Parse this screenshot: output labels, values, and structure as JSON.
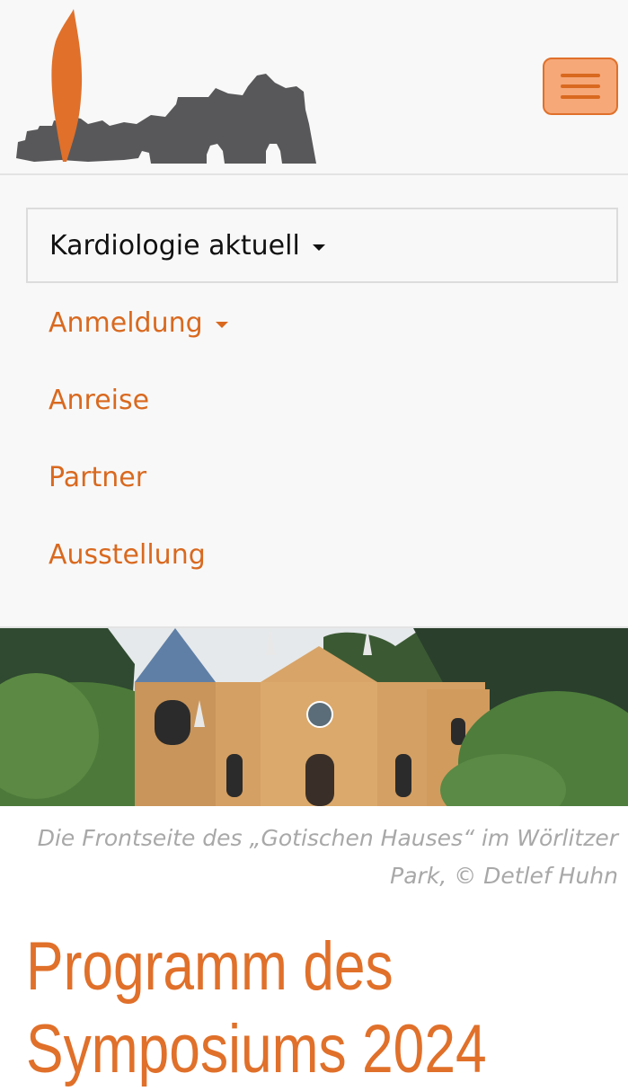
{
  "header": {
    "logo_icon": "cypress-ruin-logo-icon",
    "menu_icon": "hamburger-icon"
  },
  "nav": {
    "active_item": "Kardiologie aktuell",
    "items": [
      {
        "label": "Anmeldung",
        "has_dropdown": true
      },
      {
        "label": "Anreise",
        "has_dropdown": false
      },
      {
        "label": "Partner",
        "has_dropdown": false
      },
      {
        "label": "Ausstellung",
        "has_dropdown": false
      }
    ]
  },
  "hero": {
    "caption": "Die Frontseite des „Gotischen Hauses“ im Wörlitzer Park, © Detlef Huhn"
  },
  "main": {
    "title": "Programm des Symposiums 2024"
  },
  "colors": {
    "accent": "#e0702a",
    "nav_text": "#d9691f",
    "caption": "#a8a8a8",
    "logo_gray": "#58585a"
  }
}
